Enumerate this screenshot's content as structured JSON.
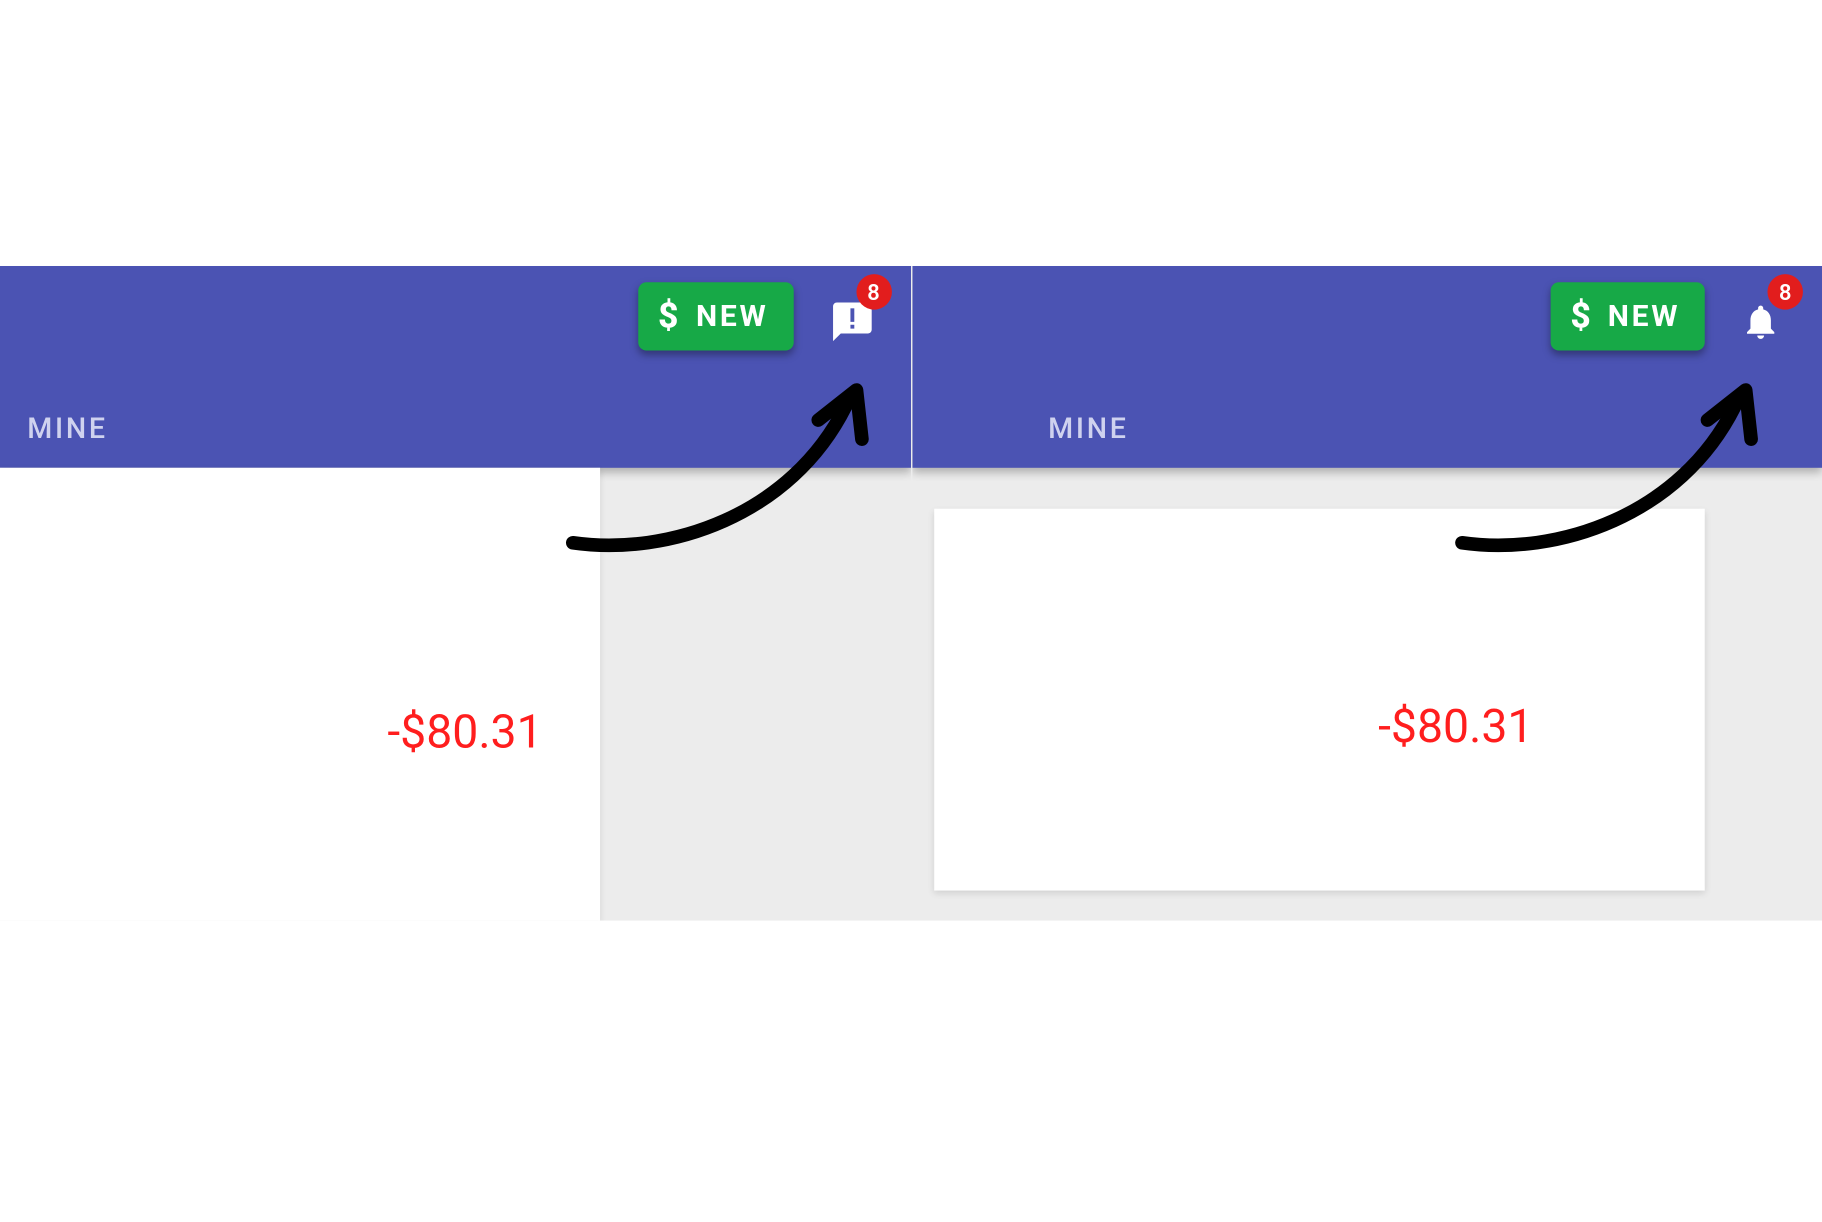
{
  "left": {
    "new_button_label": "NEW",
    "notification_badge": "8",
    "notification_icon": "chat-alert-icon",
    "tab_label": "MINE",
    "amount": "-$80.31"
  },
  "right": {
    "new_button_label": "NEW",
    "notification_badge": "8",
    "notification_icon": "bell-icon",
    "tab_label": "MINE",
    "amount": "-$80.31"
  },
  "colors": {
    "appbar": "#4b53b3",
    "new_button": "#17a947",
    "badge": "#e21d1d",
    "amount": "#ff1e1e"
  }
}
